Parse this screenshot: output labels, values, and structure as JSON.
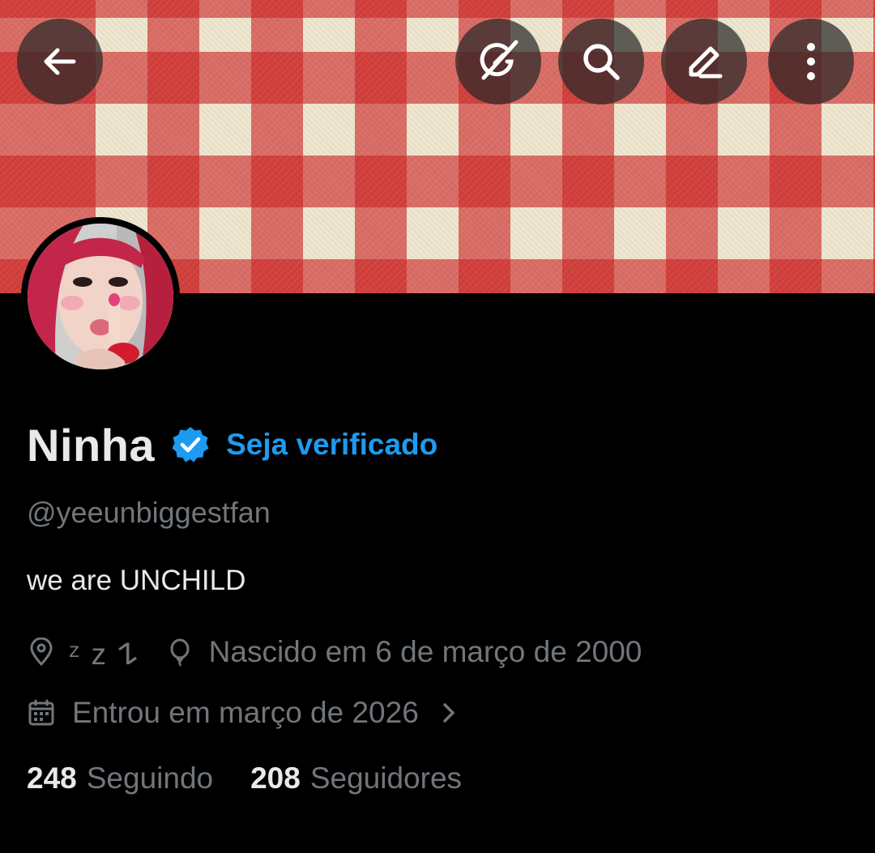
{
  "header": {
    "buttons": [
      {
        "name": "back",
        "icon": "arrow-left-icon"
      },
      {
        "name": "grok",
        "icon": "grok-icon"
      },
      {
        "name": "search",
        "icon": "search-icon"
      },
      {
        "name": "edit",
        "icon": "pencil-icon"
      },
      {
        "name": "more",
        "icon": "more-vertical-icon"
      }
    ]
  },
  "banner": {
    "pattern": "red-white-gingham",
    "colors": {
      "red": "#cd2323",
      "cream": "#efe6cf"
    }
  },
  "profile": {
    "avatar": "avatar-photo",
    "display_name": "Ninha",
    "verify_label": "Seja verificado",
    "handle": "@yeeunbiggestfan",
    "bio": "we are UNCHILD",
    "location": "ᶻ z 𐰁",
    "birth_date": "Nascido em 6 de março de 2000",
    "joined": "Entrou em março de 2026",
    "following_count": "248",
    "following_label": "Seguindo",
    "followers_count": "208",
    "followers_label": "Seguidores"
  },
  "colors": {
    "accent": "#1d9bf0",
    "secondary_text": "#71767b",
    "primary_text": "#e7e9ea",
    "background": "#000000"
  }
}
